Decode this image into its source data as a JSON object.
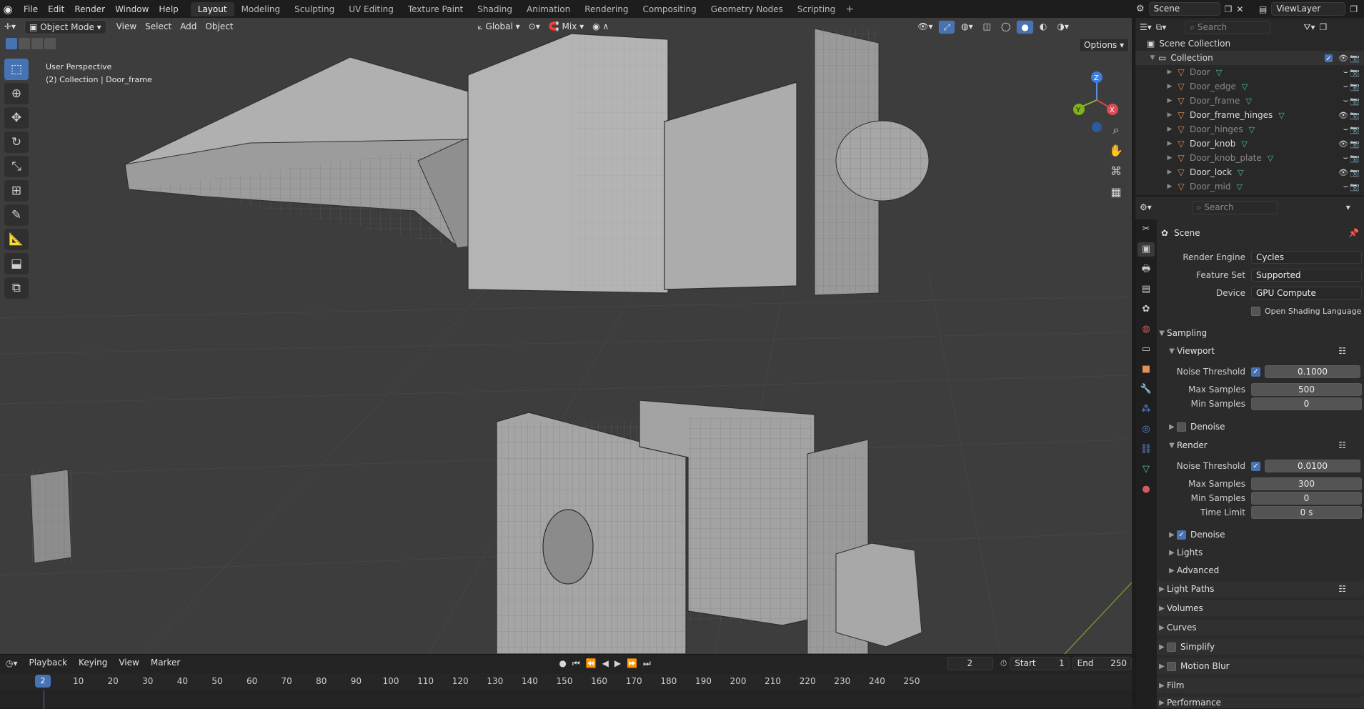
{
  "app": {
    "menu": [
      "File",
      "Edit",
      "Render",
      "Window",
      "Help"
    ],
    "workspaces": [
      "Layout",
      "Modeling",
      "Sculpting",
      "UV Editing",
      "Texture Paint",
      "Shading",
      "Animation",
      "Rendering",
      "Compositing",
      "Geometry Nodes",
      "Scripting"
    ],
    "active_workspace": "Layout",
    "scene_name": "Scene",
    "view_layer": "ViewLayer"
  },
  "viewport": {
    "mode": "Object Mode",
    "menus": [
      "View",
      "Select",
      "Add",
      "Object"
    ],
    "transform_orientation": "Global",
    "snap_mode": "Mix",
    "options_label": "Options",
    "overlay_line1": "User Perspective",
    "overlay_line2": "(2) Collection | Door_frame",
    "gizmo_axes": [
      "Z",
      "Y",
      "X"
    ]
  },
  "timeline": {
    "menus": [
      "Playback",
      "Keying",
      "View",
      "Marker"
    ],
    "current_frame": "2",
    "start_label": "Start",
    "start": "1",
    "end_label": "End",
    "end": "250",
    "ticks": [
      "10",
      "20",
      "30",
      "40",
      "50",
      "60",
      "70",
      "80",
      "90",
      "100",
      "110",
      "120",
      "130",
      "140",
      "150",
      "160",
      "170",
      "180",
      "190",
      "200",
      "210",
      "220",
      "230",
      "240",
      "250"
    ]
  },
  "outliner": {
    "search_placeholder": "Search",
    "root": "Scene Collection",
    "collection": "Collection",
    "items": [
      {
        "name": "Door",
        "dim": true,
        "visible": false
      },
      {
        "name": "Door_edge",
        "dim": true,
        "visible": false
      },
      {
        "name": "Door_frame",
        "dim": true,
        "visible": false
      },
      {
        "name": "Door_frame_hinges",
        "dim": false,
        "visible": true
      },
      {
        "name": "Door_hinges",
        "dim": true,
        "visible": false
      },
      {
        "name": "Door_knob",
        "dim": false,
        "visible": true
      },
      {
        "name": "Door_knob_plate",
        "dim": true,
        "visible": false
      },
      {
        "name": "Door_lock",
        "dim": false,
        "visible": true
      },
      {
        "name": "Door_mid",
        "dim": true,
        "visible": false
      }
    ]
  },
  "properties": {
    "search_placeholder": "Search",
    "context": "Scene",
    "render_engine_label": "Render Engine",
    "render_engine": "Cycles",
    "feature_set_label": "Feature Set",
    "feature_set": "Supported",
    "device_label": "Device",
    "device": "GPU Compute",
    "osl_label": "Open Shading Language",
    "sampling": "Sampling",
    "viewport_sub": "Viewport",
    "noise_threshold_label": "Noise Threshold",
    "vp_noise_threshold": "0.1000",
    "max_samples_label": "Max Samples",
    "vp_max_samples": "500",
    "min_samples_label": "Min Samples",
    "vp_min_samples": "0",
    "denoise_label": "Denoise",
    "render_sub": "Render",
    "r_noise_threshold": "0.0100",
    "r_max_samples": "300",
    "r_min_samples": "0",
    "time_limit_label": "Time Limit",
    "r_time_limit": "0 s",
    "lights": "Lights",
    "advanced": "Advanced",
    "light_paths": "Light Paths",
    "volumes": "Volumes",
    "curves": "Curves",
    "simplify": "Simplify",
    "motion_blur": "Motion Blur",
    "film": "Film",
    "performance": "Performance"
  },
  "colors": {
    "accent": "#4772b3",
    "object_icon": "#e0905a",
    "mesh_icon": "#4fc1a6",
    "viewport_bg": "#3d3d3d"
  }
}
